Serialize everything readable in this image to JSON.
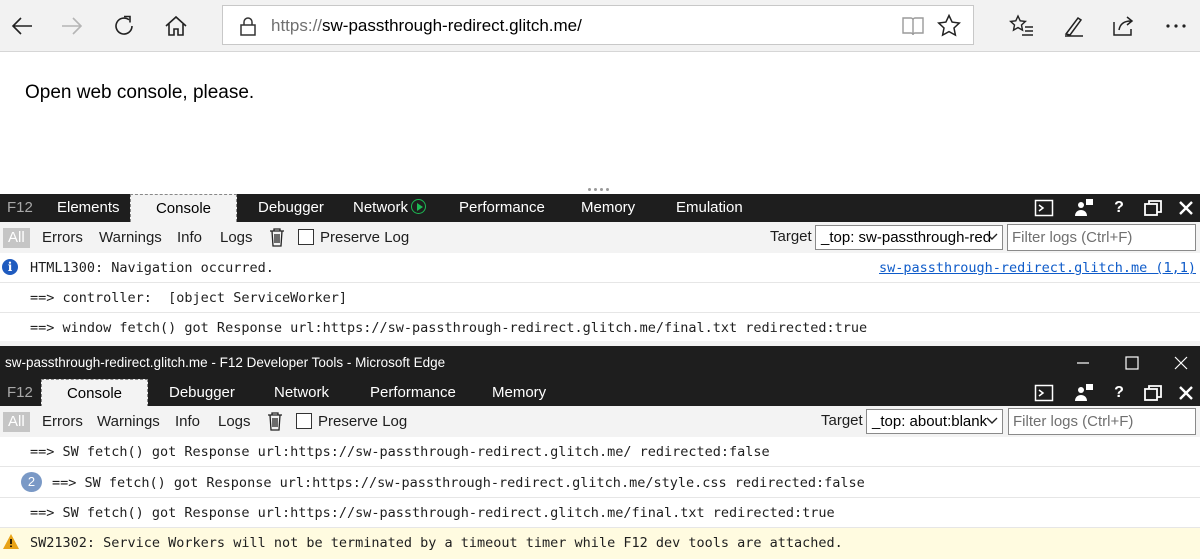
{
  "browser": {
    "url_scheme": "https://",
    "url_rest": "sw-passthrough-redirect.glitch.me/"
  },
  "page": {
    "text": "Open web console, please."
  },
  "devtools1": {
    "tabs": [
      "F12",
      "Elements",
      "Console",
      "Debugger",
      "Network",
      "Performance",
      "Memory",
      "Emulation"
    ],
    "filters": {
      "all": "All",
      "errors": "Errors",
      "warnings": "Warnings",
      "info": "Info",
      "logs": "Logs",
      "preserve": "Preserve Log"
    },
    "target_label": "Target",
    "target_value": "_top: sw-passthrough-red",
    "filter_placeholder": "Filter logs (Ctrl+F)",
    "logs": [
      {
        "text": "HTML1300: Navigation occurred.",
        "source": "sw-passthrough-redirect.glitch.me (1,1)"
      },
      {
        "text": "==> controller:  [object ServiceWorker]"
      },
      {
        "text": "==> window fetch() got Response url:https://sw-passthrough-redirect.glitch.me/final.txt redirected:true"
      }
    ]
  },
  "devtools2": {
    "window_title": "sw-passthrough-redirect.glitch.me - F12 Developer Tools - Microsoft Edge",
    "tabs": [
      "F12",
      "Console",
      "Debugger",
      "Network",
      "Performance",
      "Memory"
    ],
    "filters": {
      "all": "All",
      "errors": "Errors",
      "warnings": "Warnings",
      "info": "Info",
      "logs": "Logs",
      "preserve": "Preserve Log"
    },
    "target_label": "Target",
    "target_value": "_top: about:blank",
    "filter_placeholder": "Filter logs (Ctrl+F)",
    "logs": [
      {
        "text": "==> SW fetch() got Response url:https://sw-passthrough-redirect.glitch.me/ redirected:false"
      },
      {
        "count": "2",
        "text": "==> SW fetch() got Response url:https://sw-passthrough-redirect.glitch.me/style.css redirected:false"
      },
      {
        "text": "==> SW fetch() got Response url:https://sw-passthrough-redirect.glitch.me/final.txt redirected:true"
      },
      {
        "text": "SW21302: Service Workers will not be terminated by a timeout timer while F12 dev tools are attached."
      }
    ]
  },
  "colors": {
    "devtools_bg": "#1e1e1e",
    "link": "#0e5bc9",
    "warning_bg": "#fffbe0",
    "info": "#1f5bbf"
  }
}
